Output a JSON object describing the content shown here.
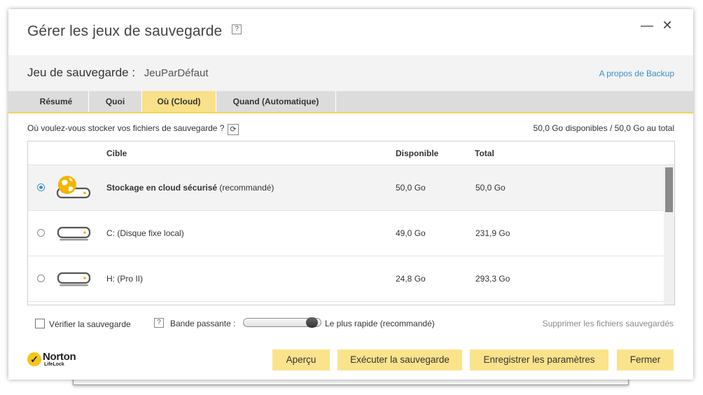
{
  "window": {
    "title": "Gérer les jeux de sauvegarde",
    "title_help": "?",
    "minimize": "—",
    "close": "✕"
  },
  "backup_set": {
    "label": "Jeu de sauvegarde :",
    "value": "JeuParDéfaut",
    "about_link": "A propos de Backup"
  },
  "tabs": [
    {
      "label": "Résumé",
      "active": false
    },
    {
      "label": "Quoi",
      "active": false
    },
    {
      "label": "Où (Cloud)",
      "active": true
    },
    {
      "label": "Quand (Automatique)",
      "active": false
    }
  ],
  "where": {
    "question": "Où voulez-vous stocker vos fichiers de sauvegarde ?",
    "space_info": "50,0 Go disponibles / 50,0 Go au total"
  },
  "table": {
    "headers": {
      "target": "Cible",
      "available": "Disponible",
      "total": "Total"
    },
    "rows": [
      {
        "target_bold": "Stockage en cloud sécurisé",
        "target_rest": " (recommandé)",
        "available": "50,0 Go",
        "total": "50,0 Go",
        "selected": true,
        "icon": "cloud-drive-icon"
      },
      {
        "target_bold": "",
        "target_rest": "C:  (Disque fixe local)",
        "available": "49,0 Go",
        "total": "231,9 Go",
        "selected": false,
        "icon": "hard-drive-icon"
      },
      {
        "target_bold": "",
        "target_rest": "H:  (Pro II)",
        "available": "24,8 Go",
        "total": "293,3 Go",
        "selected": false,
        "icon": "hard-drive-icon"
      }
    ]
  },
  "options": {
    "verify_label": "Vérifier la sauvegarde",
    "verify_checked": false,
    "bandwidth_help": "?",
    "bandwidth_label": "Bande passante :",
    "bandwidth_value": "Le plus rapide (recommandé)",
    "bandwidth_level": 1.0,
    "delete_link": "Supprimer les fichiers sauvegardés"
  },
  "logo": {
    "name": "Norton",
    "sub": "LifeLock",
    "check": "✓"
  },
  "buttons": {
    "preview": "Aperçu",
    "run": "Exécuter la sauvegarde",
    "save": "Enregistrer les paramètres",
    "close": "Fermer"
  },
  "colors": {
    "accent": "#fbe38b",
    "active_tab": "#f9e08a",
    "link": "#3a8fc9",
    "drive_accent": "#f5b400"
  }
}
